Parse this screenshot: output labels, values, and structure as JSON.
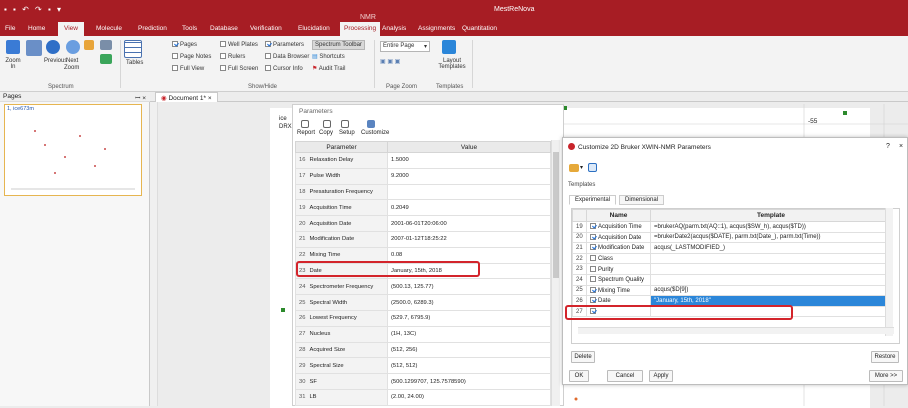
{
  "app": {
    "title": "MestReNova",
    "context_tab": "NMR"
  },
  "ribbon": {
    "tabs": [
      "File",
      "Home",
      "View",
      "Molecule",
      "Prediction",
      "Tools",
      "Database",
      "Verification",
      "Elucidation",
      "Processing",
      "Analysis",
      "Assignments",
      "Quantitation"
    ],
    "active_tab": "View",
    "zoom_in": "Zoom In",
    "zoom_out": "Zoom",
    "previous": "Previous",
    "next": "Next",
    "tables": "Tables",
    "spectrum_group": "Spectrum",
    "show_hide": {
      "pages": "Pages",
      "page_notes": "Page Notes",
      "full_view": "Full View",
      "well_plates": "Well Plates",
      "rulers": "Rulers",
      "full_screen": "Full Screen",
      "parameters": "Parameters",
      "data_browser": "Data Browser",
      "cursor_info": "Cursor Info",
      "spectrum_toolbar": "Spectrum Toolbar",
      "shortcuts": "Shortcuts",
      "audit_trail": "Audit Trail",
      "group": "Show/Hide"
    },
    "page_zoom": {
      "value": "Entire Page",
      "group": "Page Zoom"
    },
    "templates": {
      "label": "Layout Templates",
      "group": "Templates"
    }
  },
  "pages_panel": {
    "title": "Pages",
    "thumb_label": "1, ice673m"
  },
  "document_tab": "Document 1*",
  "parameters_panel": {
    "title": "Parameters",
    "partial_labels": [
      "ice",
      "DRX"
    ],
    "tools": [
      "Report",
      "Copy",
      "Setup",
      "Customize"
    ],
    "columns": [
      "Parameter",
      "Value"
    ],
    "rows": [
      {
        "n": "16",
        "name": "Relaxation Delay",
        "value": "1.5000"
      },
      {
        "n": "17",
        "name": "Pulse Width",
        "value": "9.2000"
      },
      {
        "n": "18",
        "name": "Presaturation Frequency",
        "value": ""
      },
      {
        "n": "19",
        "name": "Acquisition Time",
        "value": "0.2049"
      },
      {
        "n": "20",
        "name": "Acquisition Date",
        "value": "2001-06-01T20:06:00"
      },
      {
        "n": "21",
        "name": "Modification Date",
        "value": "2007-01-12T18:25:22"
      },
      {
        "n": "22",
        "name": "Mixing Time",
        "value": "0.08"
      },
      {
        "n": "23",
        "name": "Date",
        "value": "January, 15th, 2018"
      },
      {
        "n": "24",
        "name": "Spectrometer Frequency",
        "value": "(500.13, 125.77)"
      },
      {
        "n": "25",
        "name": "Spectral Width",
        "value": "(2500.0, 6289.3)"
      },
      {
        "n": "26",
        "name": "Lowest Frequency",
        "value": "(529.7, 6795.9)"
      },
      {
        "n": "27",
        "name": "Nucleus",
        "value": "(1H, 13C)"
      },
      {
        "n": "28",
        "name": "Acquired Size",
        "value": "(512, 256)"
      },
      {
        "n": "29",
        "name": "Spectral Size",
        "value": "(512, 512)"
      },
      {
        "n": "30",
        "name": "SF",
        "value": "(500.1299707, 125.7578590)"
      },
      {
        "n": "31",
        "name": "LB",
        "value": "(2.00, 24.00)"
      }
    ]
  },
  "axis_label_right": "-55",
  "dialog": {
    "title": "Customize 2D Bruker XWIN-NMR Parameters",
    "help": "?",
    "close": "×",
    "templates_label": "Templates",
    "tabs": [
      "Experimental",
      "Dimensional"
    ],
    "columns": [
      "Name",
      "Template"
    ],
    "rows": [
      {
        "n": "19",
        "checked": true,
        "name": "Acquisition Time",
        "template": "=brukerAQ(parm.txt(AQ::1), acqus($SW_h), acqus($TD))"
      },
      {
        "n": "20",
        "checked": true,
        "name": "Acquisition Date",
        "template": "=brukerDate2(acqus($DATE), parm.txt(Date_), parm.txt(Time))"
      },
      {
        "n": "21",
        "checked": true,
        "name": "Modification Date",
        "template": "acqus(_LASTMODIFIED_)"
      },
      {
        "n": "22",
        "checked": false,
        "name": "Class",
        "template": ""
      },
      {
        "n": "23",
        "checked": false,
        "name": "Purity",
        "template": ""
      },
      {
        "n": "24",
        "checked": false,
        "name": "Spectrum Quality",
        "template": ""
      },
      {
        "n": "25",
        "checked": true,
        "name": "Mixing Time",
        "template": "acqus($D[9])"
      },
      {
        "n": "26",
        "checked": true,
        "name": "Date",
        "template": "\"January, 15th, 2018\""
      },
      {
        "n": "27",
        "checked": true,
        "name": "",
        "template": ""
      }
    ],
    "delete": "Delete",
    "restore": "Restore",
    "ok": "OK",
    "cancel": "Cancel",
    "apply": "Apply",
    "more": "More >>"
  },
  "colors": {
    "accent": "#a71d24",
    "highlight": "#d3242b",
    "selection": "#2b86d9"
  }
}
